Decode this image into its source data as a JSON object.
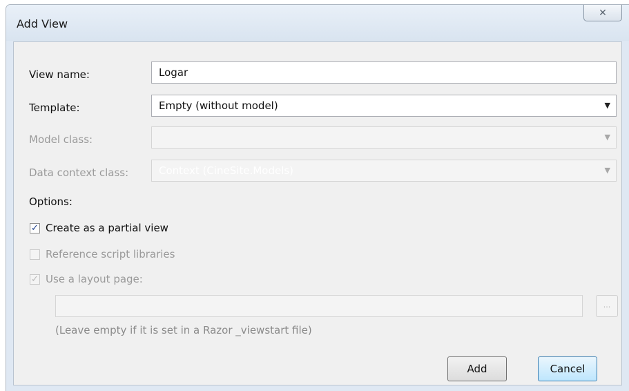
{
  "window": {
    "title": "Add View",
    "close_glyph": "✕"
  },
  "form": {
    "view_name_label": "View name:",
    "view_name_value": "Logar",
    "template_label": "Template:",
    "template_value": "Empty (without model)",
    "model_class_label": "Model class:",
    "model_class_value": "",
    "data_context_label": "Data context class:",
    "data_context_value": "Context (CineSite.Models)",
    "dropdown_glyph": "▼"
  },
  "options": {
    "heading": "Options:",
    "partial_view": {
      "label": "Create as a partial view",
      "checked": true,
      "enabled": true
    },
    "script_libs": {
      "label": "Reference script libraries",
      "checked": false,
      "enabled": false
    },
    "layout_page": {
      "label": "Use a layout page:",
      "checked": true,
      "enabled": false
    },
    "layout_path_value": "",
    "browse_label": "...",
    "hint": "(Leave empty if it is set in a Razor _viewstart file)"
  },
  "buttons": {
    "add": "Add",
    "cancel": "Cancel"
  },
  "check_glyph": "✓"
}
